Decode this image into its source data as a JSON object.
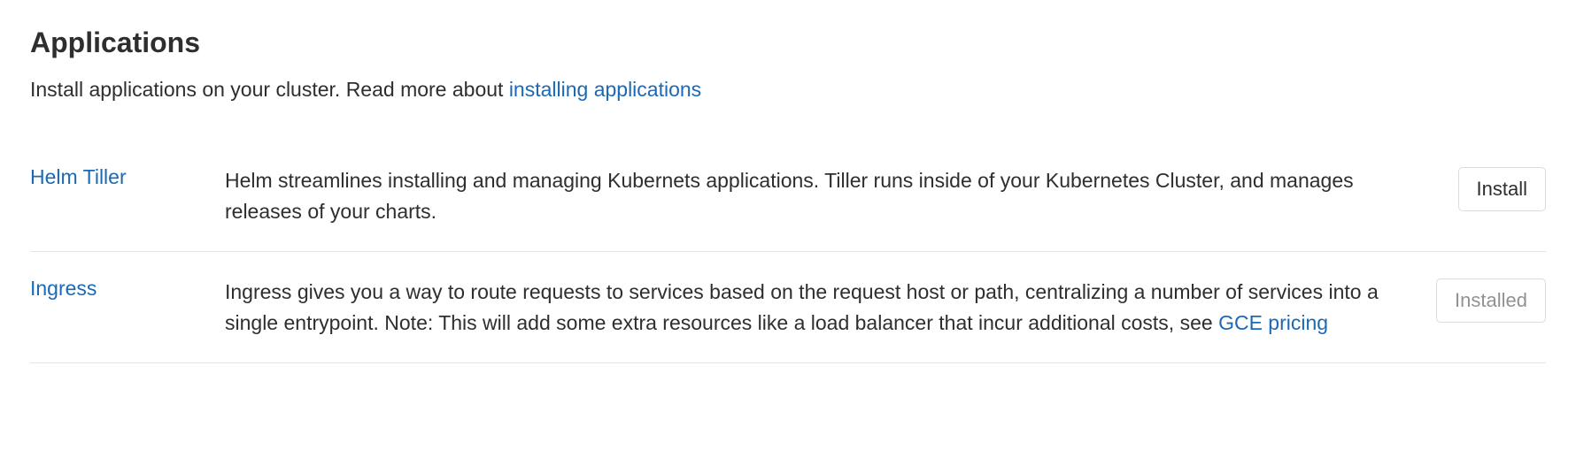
{
  "section": {
    "title": "Applications",
    "intro_prefix": "Install applications on your cluster. Read more about ",
    "intro_link": "installing applications"
  },
  "apps": [
    {
      "name": "Helm Tiller",
      "description": "Helm streamlines installing and managing Kubernets applications. Tiller runs inside of your Kubernetes Cluster, and manages releases of your charts.",
      "link_text": "",
      "button_label": "Install",
      "installed": false
    },
    {
      "name": "Ingress",
      "description": "Ingress gives you a way to route requests to services based on the request host or path, centralizing a number of services into a single entrypoint. Note: This will add some extra resources like a load balancer that incur additional costs, see ",
      "link_text": "GCE pricing",
      "button_label": "Installed",
      "installed": true
    }
  ]
}
